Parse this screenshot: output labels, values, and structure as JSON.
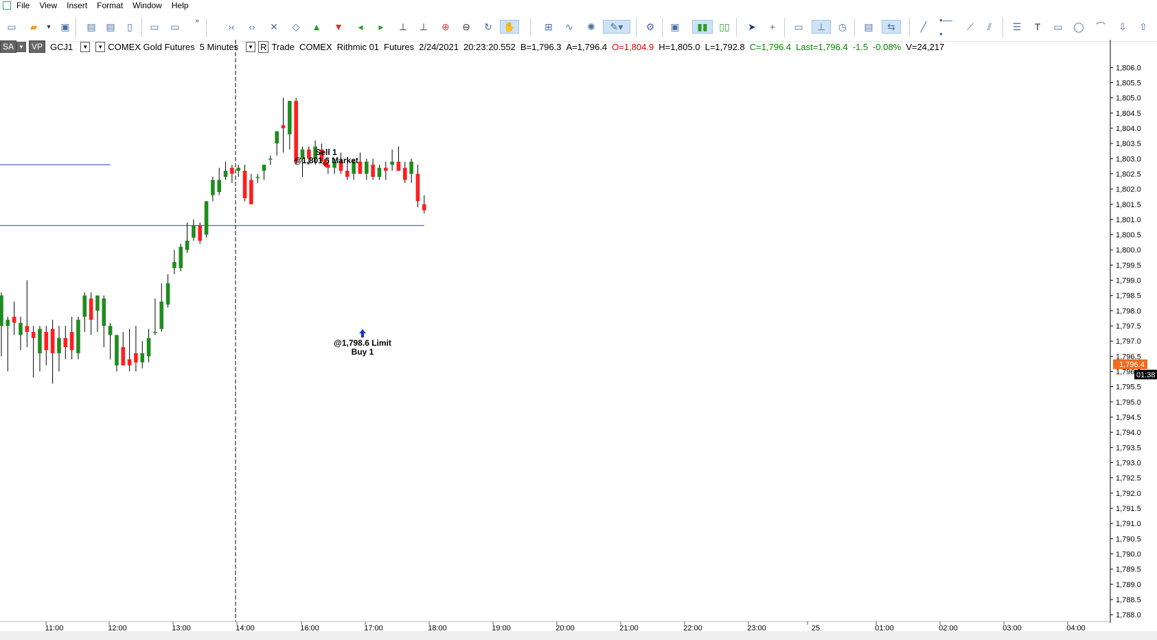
{
  "menu": {
    "items": [
      "File",
      "View",
      "Insert",
      "Format",
      "Window",
      "Help"
    ]
  },
  "infobar": {
    "sa": "SA",
    "vp": "VP",
    "symbol": "GCJ1",
    "description": "COMEX Gold Futures",
    "interval": "5 Minutes",
    "r": "R",
    "mode": "Trade",
    "exchange": "COMEX",
    "feed": "Rithmic 01",
    "category": "Futures",
    "date": "2/24/2021",
    "time": "20:23:20.552",
    "bid": "B=1,796.3",
    "ask": "A=1,796.4",
    "open": "O=1,804.9",
    "high": "H=1,805.0",
    "low": "L=1,792.8",
    "close": "C=1,796.4",
    "last": "Last=1,796.4",
    "change": "-1.5",
    "change_pct": "-0.08%",
    "volume": "V=24,217"
  },
  "colors": {
    "up": "#1e8c1e",
    "down": "#ff1e1e",
    "level_line": "#2233dd",
    "price_tag": "#f26b1d",
    "countdown": "#000000"
  },
  "annotations": {
    "sell_label": "Sell 1",
    "sell_price": "@1,801.6 Market",
    "buy_price": "@1,798.6 Limit",
    "buy_label": "Buy 1"
  },
  "price_tag": {
    "value": "1,796.4",
    "countdown": "01:38"
  },
  "chart_data": {
    "type": "candlestick",
    "ylim": [
      1787.8,
      1806.3
    ],
    "y_ticks": [
      "1,806.0",
      "1,805.5",
      "1,805.0",
      "1,804.5",
      "1,804.0",
      "1,803.5",
      "1,803.0",
      "1,802.5",
      "1,802.0",
      "1,801.5",
      "1,801.0",
      "1,800.5",
      "1,800.0",
      "1,799.5",
      "1,799.0",
      "1,798.5",
      "1,798.0",
      "1,797.5",
      "1,797.0",
      "1,796.5",
      "1,796.0",
      "1,795.5",
      "1,795.0",
      "1,794.5",
      "1,794.0",
      "1,793.5",
      "1,793.0",
      "1,792.5",
      "1,792.0",
      "1,791.5",
      "1,791.0",
      "1,790.5",
      "1,790.0",
      "1,789.5",
      "1,789.0",
      "1,788.5",
      "1,788.0"
    ],
    "x_ticks": [
      "11:00",
      "12:00",
      "13:00",
      "14:00",
      "16:00",
      "17:00",
      "18:00",
      "19:00",
      "20:00",
      "21:00",
      "22:00",
      "23:00",
      "25",
      "01:00",
      "02:00",
      "03:00",
      "04:00"
    ],
    "session_divider_x_label": "14:00",
    "levels": [
      {
        "price": 1802.8,
        "from_bar": 0,
        "to_bar": 17
      },
      {
        "price": 1800.8,
        "from_bar": 0,
        "to_bar": 66
      }
    ],
    "candles": [
      {
        "o": 1797.5,
        "h": 1798.6,
        "l": 1796.5,
        "c": 1798.5
      },
      {
        "o": 1797.5,
        "h": 1797.8,
        "l": 1796.0,
        "c": 1797.7
      },
      {
        "o": 1797.8,
        "h": 1798.3,
        "l": 1797.2,
        "c": 1797.6
      },
      {
        "o": 1797.2,
        "h": 1797.8,
        "l": 1796.7,
        "c": 1797.6
      },
      {
        "o": 1797.5,
        "h": 1799.0,
        "l": 1796.8,
        "c": 1797.3
      },
      {
        "o": 1797.3,
        "h": 1797.5,
        "l": 1795.8,
        "c": 1797.1
      },
      {
        "o": 1796.6,
        "h": 1797.5,
        "l": 1796.0,
        "c": 1797.4
      },
      {
        "o": 1797.3,
        "h": 1797.5,
        "l": 1796.2,
        "c": 1796.7
      },
      {
        "o": 1797.4,
        "h": 1797.7,
        "l": 1795.6,
        "c": 1796.6
      },
      {
        "o": 1796.6,
        "h": 1797.5,
        "l": 1796.0,
        "c": 1797.1
      },
      {
        "o": 1797.1,
        "h": 1797.5,
        "l": 1796.4,
        "c": 1796.8
      },
      {
        "o": 1797.3,
        "h": 1797.8,
        "l": 1796.4,
        "c": 1796.7
      },
      {
        "o": 1796.6,
        "h": 1797.8,
        "l": 1796.4,
        "c": 1797.7
      },
      {
        "o": 1797.8,
        "h": 1798.6,
        "l": 1797.3,
        "c": 1798.5
      },
      {
        "o": 1798.4,
        "h": 1798.6,
        "l": 1797.2,
        "c": 1797.7
      },
      {
        "o": 1798.0,
        "h": 1798.5,
        "l": 1797.3,
        "c": 1798.5
      },
      {
        "o": 1797.5,
        "h": 1798.5,
        "l": 1796.8,
        "c": 1798.4
      },
      {
        "o": 1797.2,
        "h": 1797.6,
        "l": 1796.4,
        "c": 1797.5
      },
      {
        "o": 1796.2,
        "h": 1797.2,
        "l": 1796.0,
        "c": 1797.2
      },
      {
        "o": 1796.8,
        "h": 1797.3,
        "l": 1796.2,
        "c": 1796.2
      },
      {
        "o": 1796.4,
        "h": 1797.4,
        "l": 1796.0,
        "c": 1796.2
      },
      {
        "o": 1796.6,
        "h": 1797.5,
        "l": 1796.0,
        "c": 1796.3
      },
      {
        "o": 1796.3,
        "h": 1797.0,
        "l": 1796.1,
        "c": 1796.6
      },
      {
        "o": 1796.5,
        "h": 1797.4,
        "l": 1796.3,
        "c": 1797.1
      },
      {
        "o": 1797.3,
        "h": 1798.4,
        "l": 1797.2,
        "c": 1797.3
      },
      {
        "o": 1797.4,
        "h": 1798.9,
        "l": 1797.3,
        "c": 1798.3
      },
      {
        "o": 1798.2,
        "h": 1799.2,
        "l": 1798.1,
        "c": 1798.9
      },
      {
        "o": 1799.4,
        "h": 1800.0,
        "l": 1799.2,
        "c": 1799.6
      },
      {
        "o": 1799.4,
        "h": 1800.2,
        "l": 1799.3,
        "c": 1800.1
      },
      {
        "o": 1800.0,
        "h": 1800.9,
        "l": 1799.9,
        "c": 1800.3
      },
      {
        "o": 1800.4,
        "h": 1801.0,
        "l": 1800.3,
        "c": 1800.8
      },
      {
        "o": 1800.8,
        "h": 1800.9,
        "l": 1800.2,
        "c": 1800.3
      },
      {
        "o": 1800.5,
        "h": 1801.2,
        "l": 1800.4,
        "c": 1801.6
      },
      {
        "o": 1801.8,
        "h": 1802.4,
        "l": 1801.6,
        "c": 1802.3
      },
      {
        "o": 1801.9,
        "h": 1802.7,
        "l": 1801.8,
        "c": 1802.3
      },
      {
        "o": 1802.4,
        "h": 1802.9,
        "l": 1802.3,
        "c": 1802.6
      },
      {
        "o": 1802.7,
        "h": 1802.8,
        "l": 1802.2,
        "c": 1802.5
      },
      {
        "o": 1802.6,
        "h": 1802.8,
        "l": 1802.4,
        "c": 1802.7
      },
      {
        "o": 1802.6,
        "h": 1802.8,
        "l": 1801.6,
        "c": 1801.7
      },
      {
        "o": 1802.3,
        "h": 1802.5,
        "l": 1801.5,
        "c": 1801.5
      },
      {
        "o": 1802.4,
        "h": 1802.5,
        "l": 1802.2,
        "c": 1802.4
      },
      {
        "o": 1802.6,
        "h": 1802.8,
        "l": 1802.3,
        "c": 1802.8
      },
      {
        "o": 1803.0,
        "h": 1803.1,
        "l": 1802.8,
        "c": 1803.0
      },
      {
        "o": 1803.5,
        "h": 1803.9,
        "l": 1803.1,
        "c": 1803.9
      },
      {
        "o": 1804.1,
        "h": 1805.0,
        "l": 1803.2,
        "c": 1804.0
      },
      {
        "o": 1803.8,
        "h": 1804.9,
        "l": 1803.3,
        "c": 1804.9
      },
      {
        "o": 1804.9,
        "h": 1805.0,
        "l": 1802.8,
        "c": 1802.9
      },
      {
        "o": 1803.0,
        "h": 1803.4,
        "l": 1802.4,
        "c": 1803.3
      },
      {
        "o": 1803.3,
        "h": 1803.4,
        "l": 1802.8,
        "c": 1803.0
      },
      {
        "o": 1803.0,
        "h": 1803.6,
        "l": 1802.8,
        "c": 1803.4
      },
      {
        "o": 1803.3,
        "h": 1803.5,
        "l": 1802.9,
        "c": 1802.9
      },
      {
        "o": 1802.8,
        "h": 1803.0,
        "l": 1802.5,
        "c": 1802.7
      },
      {
        "o": 1802.7,
        "h": 1803.0,
        "l": 1802.5,
        "c": 1802.9
      },
      {
        "o": 1802.9,
        "h": 1803.2,
        "l": 1802.5,
        "c": 1802.6
      },
      {
        "o": 1802.6,
        "h": 1802.9,
        "l": 1802.3,
        "c": 1802.4
      },
      {
        "o": 1802.5,
        "h": 1803.0,
        "l": 1802.3,
        "c": 1802.9
      },
      {
        "o": 1802.9,
        "h": 1803.2,
        "l": 1802.5,
        "c": 1802.5
      },
      {
        "o": 1802.5,
        "h": 1803.0,
        "l": 1802.3,
        "c": 1802.9
      },
      {
        "o": 1802.8,
        "h": 1803.0,
        "l": 1802.3,
        "c": 1802.4
      },
      {
        "o": 1802.4,
        "h": 1802.8,
        "l": 1802.3,
        "c": 1802.7
      },
      {
        "o": 1802.7,
        "h": 1802.9,
        "l": 1802.3,
        "c": 1802.6
      },
      {
        "o": 1802.8,
        "h": 1803.3,
        "l": 1802.6,
        "c": 1802.9
      },
      {
        "o": 1802.9,
        "h": 1803.4,
        "l": 1802.6,
        "c": 1802.6
      },
      {
        "o": 1802.7,
        "h": 1802.9,
        "l": 1802.2,
        "c": 1802.3
      },
      {
        "o": 1802.5,
        "h": 1803.0,
        "l": 1802.2,
        "c": 1802.9
      },
      {
        "o": 1802.5,
        "h": 1802.8,
        "l": 1801.4,
        "c": 1801.6
      },
      {
        "o": 1801.5,
        "h": 1801.8,
        "l": 1801.2,
        "c": 1801.3
      }
    ]
  }
}
